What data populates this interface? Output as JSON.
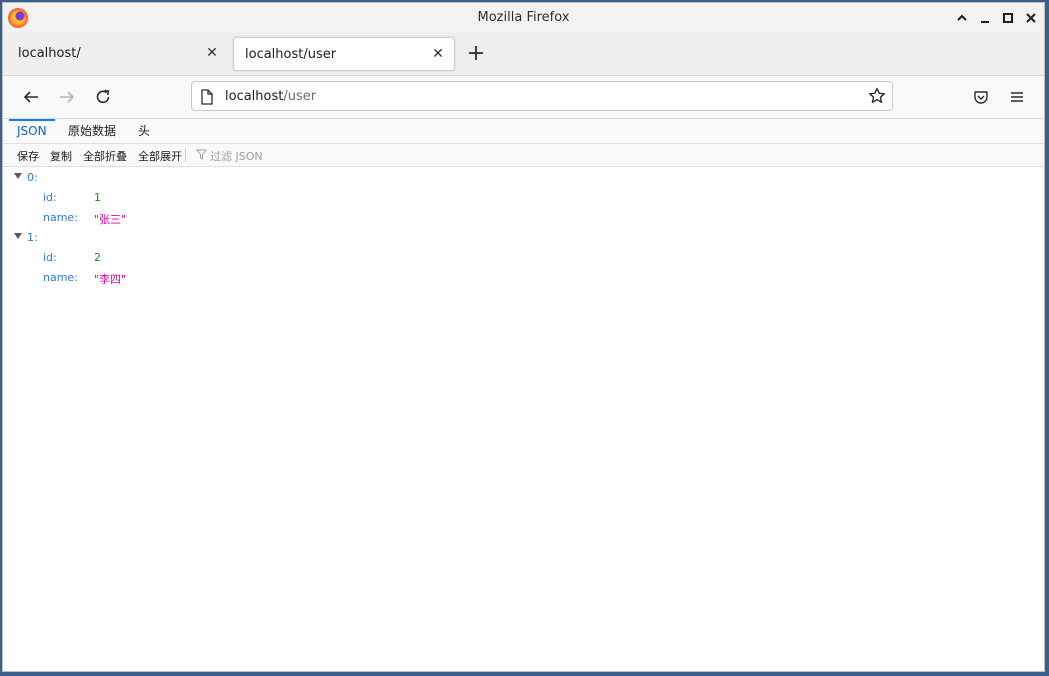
{
  "window": {
    "title": "Mozilla Firefox"
  },
  "tabs": [
    {
      "label": "localhost/",
      "active": false
    },
    {
      "label": "localhost/user",
      "active": true
    }
  ],
  "address": {
    "host": "localhost",
    "path": "/user"
  },
  "json_viewer": {
    "tabs": [
      "JSON",
      "原始数据",
      "头"
    ],
    "toolbar": {
      "save": "保存",
      "copy": "复制",
      "collapse_all": "全部折叠",
      "expand_all": "全部展开",
      "filter_placeholder": "过滤 JSON"
    },
    "items": [
      {
        "index": "0:",
        "id_key": "id:",
        "id": "1",
        "name_key": "name:",
        "name": "\"张三\""
      },
      {
        "index": "1:",
        "id_key": "id:",
        "id": "2",
        "name_key": "name:",
        "name": "\"李四\""
      }
    ]
  },
  "icons": {
    "logo": "firefox-logo-icon",
    "back": "back-arrow-icon",
    "forward": "forward-arrow-icon",
    "reload": "reload-icon",
    "page": "page-icon",
    "bookmark": "star-icon",
    "pocket": "pocket-icon",
    "menu": "hamburger-menu-icon",
    "filter": "filter-icon"
  },
  "colors": {
    "json_key": "#2a7bd6",
    "json_number": "#1d8f1d",
    "json_string": "#dd00a9",
    "selected_tab": "#0a84ff"
  }
}
